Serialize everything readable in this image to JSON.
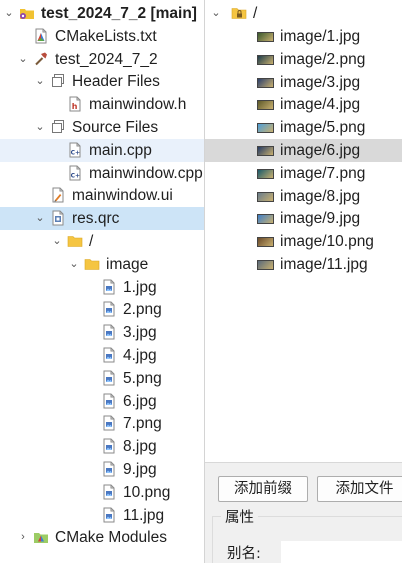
{
  "project_tree": [
    {
      "label": "test_2024_7_2 [main]",
      "icon": "project-icon",
      "arrow": "expanded",
      "bold": true
    },
    {
      "label": "CMakeLists.txt",
      "icon": "cmake-file-icon",
      "arrow": "none"
    },
    {
      "label": "test_2024_7_2",
      "icon": "hammer-icon",
      "arrow": "expanded"
    },
    {
      "label": "Header Files",
      "icon": "header-folder-icon",
      "arrow": "expanded"
    },
    {
      "label": "mainwindow.h",
      "icon": "header-file-icon",
      "arrow": "none"
    },
    {
      "label": "Source Files",
      "icon": "source-folder-icon",
      "arrow": "expanded"
    },
    {
      "label": "main.cpp",
      "icon": "cpp-file-icon",
      "arrow": "none",
      "current": true
    },
    {
      "label": "mainwindow.cpp",
      "icon": "cpp-file-icon",
      "arrow": "none"
    },
    {
      "label": "mainwindow.ui",
      "icon": "ui-file-icon",
      "arrow": "none"
    },
    {
      "label": "res.qrc",
      "icon": "qrc-file-icon",
      "arrow": "expanded",
      "selected": true
    },
    {
      "label": "/",
      "icon": "folder-icon",
      "arrow": "expanded"
    },
    {
      "label": "image",
      "icon": "folder-icon",
      "arrow": "expanded"
    },
    {
      "label": "1.jpg",
      "icon": "image-file-icon",
      "arrow": "none"
    },
    {
      "label": "2.png",
      "icon": "image-file-icon",
      "arrow": "none"
    },
    {
      "label": "3.jpg",
      "icon": "image-file-icon",
      "arrow": "none"
    },
    {
      "label": "4.jpg",
      "icon": "image-file-icon",
      "arrow": "none"
    },
    {
      "label": "5.png",
      "icon": "image-file-icon",
      "arrow": "none"
    },
    {
      "label": "6.jpg",
      "icon": "image-file-icon",
      "arrow": "none"
    },
    {
      "label": "7.png",
      "icon": "image-file-icon",
      "arrow": "none"
    },
    {
      "label": "8.jpg",
      "icon": "image-file-icon",
      "arrow": "none"
    },
    {
      "label": "9.jpg",
      "icon": "image-file-icon",
      "arrow": "none"
    },
    {
      "label": "10.png",
      "icon": "image-file-icon",
      "arrow": "none"
    },
    {
      "label": "11.jpg",
      "icon": "image-file-icon",
      "arrow": "none"
    },
    {
      "label": "CMake Modules",
      "icon": "cmake-modules-icon",
      "arrow": "collapsed"
    }
  ],
  "resource_tree": {
    "root": {
      "label": "/",
      "icon": "prefix-lock-folder-icon",
      "arrow": "expanded"
    },
    "files": [
      {
        "label": "image/1.jpg",
        "thumb": "#3b5a2e"
      },
      {
        "label": "image/2.png",
        "thumb": "#1d3b4a"
      },
      {
        "label": "image/3.jpg",
        "thumb": "#2c3f6b"
      },
      {
        "label": "image/4.jpg",
        "thumb": "#5e5a2a"
      },
      {
        "label": "image/5.png",
        "thumb": "#4f9fd8"
      },
      {
        "label": "image/6.jpg",
        "thumb": "#243a63",
        "selected": true
      },
      {
        "label": "image/7.png",
        "thumb": "#1a5a6a"
      },
      {
        "label": "image/8.jpg",
        "thumb": "#6a7d8c"
      },
      {
        "label": "image/9.jpg",
        "thumb": "#3f7fc8"
      },
      {
        "label": "image/10.png",
        "thumb": "#6b4a2a"
      },
      {
        "label": "image/11.jpg",
        "thumb": "#5a6a7a"
      }
    ]
  },
  "buttons": {
    "add_prefix": "添加前缀",
    "add_files": "添加文件"
  },
  "properties": {
    "title": "属性",
    "alias_label": "别名:",
    "alias_value": ""
  },
  "colors": {
    "selected_row": "#cde4f7",
    "current_row": "#e9f1fb",
    "resource_selected_row": "#d9d9d9",
    "panel_bg": "#f0f0f0"
  }
}
